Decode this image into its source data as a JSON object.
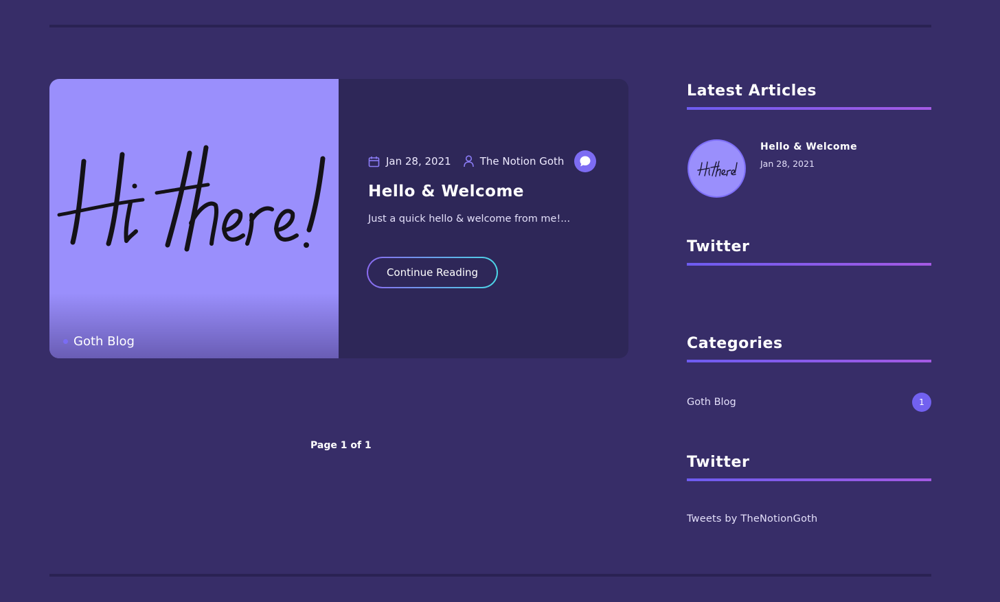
{
  "post": {
    "image_text": "Hi there!",
    "category": "Goth Blog",
    "date": "Jan 28, 2021",
    "author": "The Notion Goth",
    "title": "Hello & Welcome",
    "excerpt": "Just a quick hello & welcome from me!...",
    "continue_label": "Continue Reading"
  },
  "pagination": {
    "label": "Page 1 of 1"
  },
  "sidebar": {
    "latest": {
      "title": "Latest Articles",
      "items": [
        {
          "thumb_text": "Hi there!",
          "title": "Hello & Welcome",
          "date": "Jan 28, 2021"
        }
      ]
    },
    "twitter1": {
      "title": "Twitter"
    },
    "categories": {
      "title": "Categories",
      "items": [
        {
          "label": "Goth Blog",
          "count": "1"
        }
      ]
    },
    "twitter2": {
      "title": "Twitter",
      "link": "Tweets by TheNotionGoth"
    }
  },
  "colors": {
    "background": "#372d68",
    "card": "#2e2758",
    "image_bg": "#9a8ffc",
    "accent": "#7d6cf3",
    "gradient_start": "#6d5cf0",
    "gradient_end": "#a45ae3"
  }
}
